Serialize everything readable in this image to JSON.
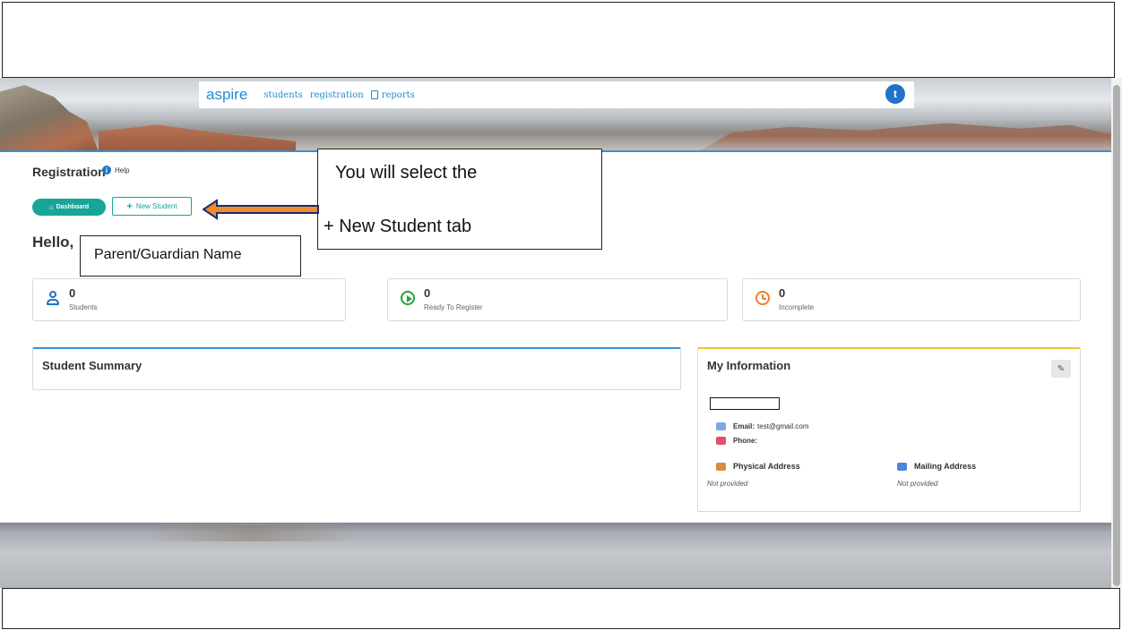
{
  "nav": {
    "brand": "aspire",
    "links": [
      "students",
      "registration",
      "reports"
    ],
    "avatar_initial": "t"
  },
  "page": {
    "title": "Registration",
    "help": "Help",
    "dashboard_button": "Dashboard",
    "new_student_button": "New Student",
    "greeting": "Hello,"
  },
  "stats": [
    {
      "value": "0",
      "label": "Students",
      "icon": "user-icon",
      "color": "#1f73c9"
    },
    {
      "value": "0",
      "label": "Ready To Register",
      "icon": "play-circle-icon",
      "color": "#23a43a"
    },
    {
      "value": "0",
      "label": "Incomplete",
      "icon": "clock-icon",
      "color": "#f07d2a"
    }
  ],
  "student_summary": {
    "title": "Student Summary"
  },
  "my_information": {
    "title": "My Information",
    "email_label": "Email:",
    "email_value": "test@gmail.com",
    "phone_label": "Phone:",
    "physical_address_label": "Physical Address",
    "mailing_address_label": "Mailing Address",
    "physical_address_value": "Not provided",
    "mailing_address_value": "Not provided"
  },
  "annotations": {
    "callout_line1": "You will select the",
    "callout_line2": "+ New Student tab",
    "name_placeholder": "Parent/Guardian Name"
  },
  "colors": {
    "brand_blue": "#1f8fd1",
    "teal": "#17a598",
    "arrow_orange": "#f08a2e",
    "info_accent": "#f2c12e"
  }
}
